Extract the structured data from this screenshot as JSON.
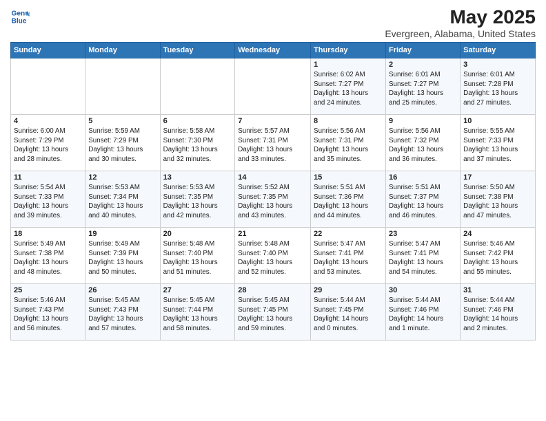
{
  "logo": {
    "line1": "General",
    "line2": "Blue"
  },
  "title": "May 2025",
  "subtitle": "Evergreen, Alabama, United States",
  "days_of_week": [
    "Sunday",
    "Monday",
    "Tuesday",
    "Wednesday",
    "Thursday",
    "Friday",
    "Saturday"
  ],
  "weeks": [
    [
      {
        "day": "",
        "info": ""
      },
      {
        "day": "",
        "info": ""
      },
      {
        "day": "",
        "info": ""
      },
      {
        "day": "",
        "info": ""
      },
      {
        "day": "1",
        "info": "Sunrise: 6:02 AM\nSunset: 7:27 PM\nDaylight: 13 hours\nand 24 minutes."
      },
      {
        "day": "2",
        "info": "Sunrise: 6:01 AM\nSunset: 7:27 PM\nDaylight: 13 hours\nand 25 minutes."
      },
      {
        "day": "3",
        "info": "Sunrise: 6:01 AM\nSunset: 7:28 PM\nDaylight: 13 hours\nand 27 minutes."
      }
    ],
    [
      {
        "day": "4",
        "info": "Sunrise: 6:00 AM\nSunset: 7:29 PM\nDaylight: 13 hours\nand 28 minutes."
      },
      {
        "day": "5",
        "info": "Sunrise: 5:59 AM\nSunset: 7:29 PM\nDaylight: 13 hours\nand 30 minutes."
      },
      {
        "day": "6",
        "info": "Sunrise: 5:58 AM\nSunset: 7:30 PM\nDaylight: 13 hours\nand 32 minutes."
      },
      {
        "day": "7",
        "info": "Sunrise: 5:57 AM\nSunset: 7:31 PM\nDaylight: 13 hours\nand 33 minutes."
      },
      {
        "day": "8",
        "info": "Sunrise: 5:56 AM\nSunset: 7:31 PM\nDaylight: 13 hours\nand 35 minutes."
      },
      {
        "day": "9",
        "info": "Sunrise: 5:56 AM\nSunset: 7:32 PM\nDaylight: 13 hours\nand 36 minutes."
      },
      {
        "day": "10",
        "info": "Sunrise: 5:55 AM\nSunset: 7:33 PM\nDaylight: 13 hours\nand 37 minutes."
      }
    ],
    [
      {
        "day": "11",
        "info": "Sunrise: 5:54 AM\nSunset: 7:33 PM\nDaylight: 13 hours\nand 39 minutes."
      },
      {
        "day": "12",
        "info": "Sunrise: 5:53 AM\nSunset: 7:34 PM\nDaylight: 13 hours\nand 40 minutes."
      },
      {
        "day": "13",
        "info": "Sunrise: 5:53 AM\nSunset: 7:35 PM\nDaylight: 13 hours\nand 42 minutes."
      },
      {
        "day": "14",
        "info": "Sunrise: 5:52 AM\nSunset: 7:35 PM\nDaylight: 13 hours\nand 43 minutes."
      },
      {
        "day": "15",
        "info": "Sunrise: 5:51 AM\nSunset: 7:36 PM\nDaylight: 13 hours\nand 44 minutes."
      },
      {
        "day": "16",
        "info": "Sunrise: 5:51 AM\nSunset: 7:37 PM\nDaylight: 13 hours\nand 46 minutes."
      },
      {
        "day": "17",
        "info": "Sunrise: 5:50 AM\nSunset: 7:38 PM\nDaylight: 13 hours\nand 47 minutes."
      }
    ],
    [
      {
        "day": "18",
        "info": "Sunrise: 5:49 AM\nSunset: 7:38 PM\nDaylight: 13 hours\nand 48 minutes."
      },
      {
        "day": "19",
        "info": "Sunrise: 5:49 AM\nSunset: 7:39 PM\nDaylight: 13 hours\nand 50 minutes."
      },
      {
        "day": "20",
        "info": "Sunrise: 5:48 AM\nSunset: 7:40 PM\nDaylight: 13 hours\nand 51 minutes."
      },
      {
        "day": "21",
        "info": "Sunrise: 5:48 AM\nSunset: 7:40 PM\nDaylight: 13 hours\nand 52 minutes."
      },
      {
        "day": "22",
        "info": "Sunrise: 5:47 AM\nSunset: 7:41 PM\nDaylight: 13 hours\nand 53 minutes."
      },
      {
        "day": "23",
        "info": "Sunrise: 5:47 AM\nSunset: 7:41 PM\nDaylight: 13 hours\nand 54 minutes."
      },
      {
        "day": "24",
        "info": "Sunrise: 5:46 AM\nSunset: 7:42 PM\nDaylight: 13 hours\nand 55 minutes."
      }
    ],
    [
      {
        "day": "25",
        "info": "Sunrise: 5:46 AM\nSunset: 7:43 PM\nDaylight: 13 hours\nand 56 minutes."
      },
      {
        "day": "26",
        "info": "Sunrise: 5:45 AM\nSunset: 7:43 PM\nDaylight: 13 hours\nand 57 minutes."
      },
      {
        "day": "27",
        "info": "Sunrise: 5:45 AM\nSunset: 7:44 PM\nDaylight: 13 hours\nand 58 minutes."
      },
      {
        "day": "28",
        "info": "Sunrise: 5:45 AM\nSunset: 7:45 PM\nDaylight: 13 hours\nand 59 minutes."
      },
      {
        "day": "29",
        "info": "Sunrise: 5:44 AM\nSunset: 7:45 PM\nDaylight: 14 hours\nand 0 minutes."
      },
      {
        "day": "30",
        "info": "Sunrise: 5:44 AM\nSunset: 7:46 PM\nDaylight: 14 hours\nand 1 minute."
      },
      {
        "day": "31",
        "info": "Sunrise: 5:44 AM\nSunset: 7:46 PM\nDaylight: 14 hours\nand 2 minutes."
      }
    ]
  ]
}
